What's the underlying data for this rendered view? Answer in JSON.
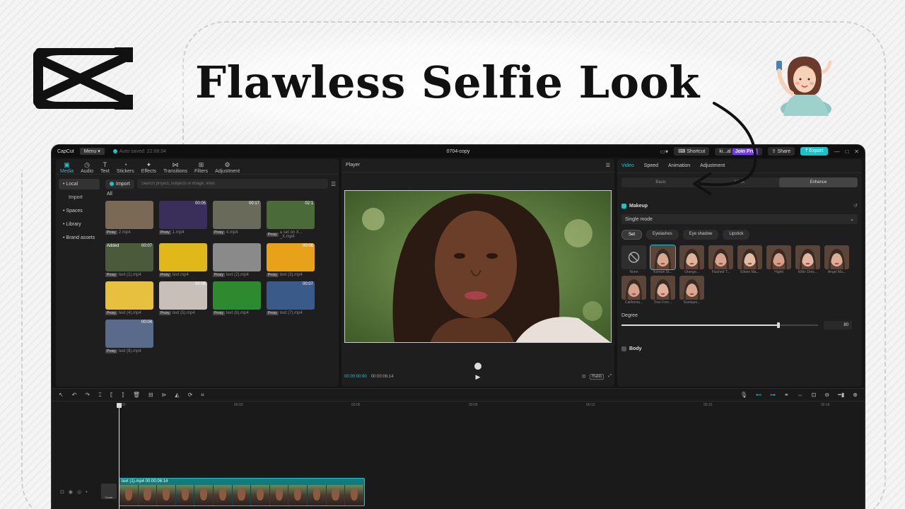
{
  "headline": "Flawless Selfie Look",
  "colors": {
    "accent": "#19c3c9",
    "pro": "#6f3cf0"
  },
  "titlebar": {
    "app_name": "CapCut",
    "menu": "Menu ▾",
    "auto_saved": "Auto saved: 22:08:34",
    "project": "0704-copy",
    "shortcut": "Shortcut",
    "user": "ki...al",
    "join_pro": "Join Pro",
    "share": "Share",
    "export": "Export"
  },
  "media": {
    "tabs": [
      {
        "label": "Media",
        "icon": "media-icon"
      },
      {
        "label": "Audio",
        "icon": "audio-icon"
      },
      {
        "label": "Text",
        "icon": "text-icon"
      },
      {
        "label": "Stickers",
        "icon": "stickers-icon"
      },
      {
        "label": "Effects",
        "icon": "effects-icon"
      },
      {
        "label": "Transitions",
        "icon": "transitions-icon"
      },
      {
        "label": "Filters",
        "icon": "filters-icon"
      },
      {
        "label": "Adjustment",
        "icon": "adjustment-icon"
      }
    ],
    "side": [
      "• Local",
      "Import",
      "• Spaces",
      "• Library",
      "• Brand assets"
    ],
    "import_label": "Import",
    "search_placeholder": "Search project, subjects in image, lines",
    "filter_all": "All",
    "proxy": "Proxy",
    "added": "Added",
    "items": [
      {
        "name": "2.mp4",
        "dur": "",
        "bg": "#7a6a55"
      },
      {
        "name": "1.mp4",
        "dur": "00:05",
        "bg": "#3a2e5a"
      },
      {
        "name": "4.mp4",
        "dur": "00:17",
        "bg": "#6a6a5a"
      },
      {
        "name": "a set on X... _X.mp4",
        "dur": "02:1",
        "bg": "#4a6a3a"
      },
      {
        "name": "text (1).mp4",
        "dur": "00:07",
        "bg": "#4a5a3a"
      },
      {
        "name": "text.mp4",
        "dur": "",
        "bg": "#e0b81a"
      },
      {
        "name": "text (2).mp4",
        "dur": "",
        "bg": "#8a8a8a"
      },
      {
        "name": "text (3).mp4",
        "dur": "00:06",
        "bg": "#e8a21a"
      },
      {
        "name": "text (4).mp4",
        "dur": "",
        "bg": "#e8c040"
      },
      {
        "name": "text (5).mp4",
        "dur": "00:06",
        "bg": "#c8c0b8"
      },
      {
        "name": "text (6).mp4",
        "dur": "",
        "bg": "#2e8a2e"
      },
      {
        "name": "text (7).mp4",
        "dur": "00:07",
        "bg": "#3a5a8a"
      },
      {
        "name": "text (8).mp4",
        "dur": "00:04",
        "bg": "#5a6a8a"
      }
    ]
  },
  "player": {
    "title": "Player",
    "current": "00:00:00:00",
    "total": "00:00:06:14",
    "ratio": "Ratio"
  },
  "rpanel": {
    "tabs": [
      "Video",
      "Speed",
      "Animation",
      "Adjustment"
    ],
    "segments": [
      "Basic",
      "Mask",
      "Enhance"
    ],
    "makeup": "Makeup",
    "mode": "Single mode",
    "chips": [
      "Set",
      "Eyelashes",
      "Eye shadow",
      "Lipstick"
    ],
    "presets": [
      "None",
      "Korean St...",
      "Orange...",
      "Flushed T...",
      "Eileen Ma...",
      "Hightl",
      "Killer Dres...",
      "Angel Ma...",
      "California...",
      "Tree Frec...",
      "Sundaze..."
    ],
    "degree": "Degree",
    "degree_value": "80",
    "degree_fraction": 0.8,
    "body": "Body"
  },
  "timeline": {
    "ticks": [
      "00:00",
      "00:03",
      "00:06",
      "00:09",
      "00:12",
      "00:15",
      "00:18"
    ],
    "clip_label": "text (1).mp4  00:00:06:14",
    "cover": "Cover"
  }
}
